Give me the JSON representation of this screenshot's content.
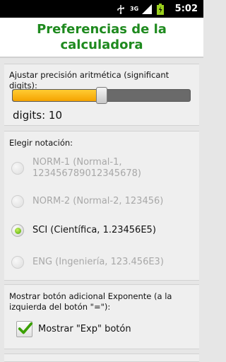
{
  "status_bar": {
    "time": "5:02",
    "network": "3G",
    "icons": [
      "usb-icon",
      "signal-icon",
      "battery-icon"
    ]
  },
  "title": "Preferencias de la calculadora",
  "precision": {
    "label": "Ajustar precisión aritmética (significant digits):",
    "slider_value_fraction": 0.5,
    "digits_text": "digits: 10"
  },
  "notation": {
    "label": "Elegir notación:",
    "options": [
      {
        "label": "NORM-1 (Normal-1, 123456789012345678)",
        "selected": false,
        "enabled": false
      },
      {
        "label": "NORM-2 (Normal-2, 123456)",
        "selected": false,
        "enabled": false
      },
      {
        "label": "SCI (Científica, 1.23456E5)",
        "selected": true,
        "enabled": true
      },
      {
        "label": "ENG (Ingeniería, 123.456E3)",
        "selected": false,
        "enabled": false
      }
    ]
  },
  "exp_button": {
    "label": "Mostrar botón adicional Exponente (a la izquierda del botón \"=\"):",
    "checkbox_label": "Mostrar \"Exp\" botón",
    "checked": true
  },
  "colors": {
    "title_green": "#1e8a1e",
    "slider_fill": "#f5a300",
    "radio_selected": "#4aa800",
    "check_green": "#3aa000"
  }
}
